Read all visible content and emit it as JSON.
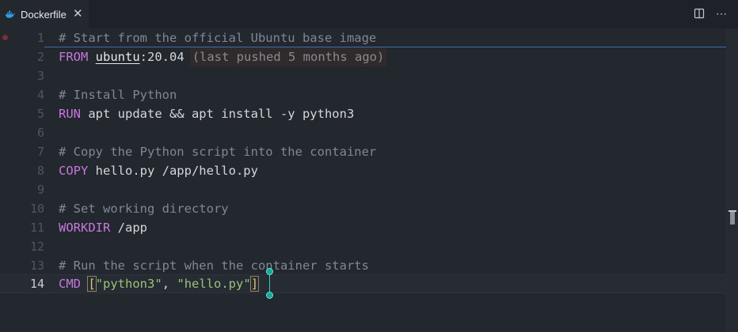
{
  "tab": {
    "title": "Dockerfile",
    "icon": "docker-icon",
    "close_glyph": "✕"
  },
  "actions": {
    "split_icon": "split-editor-icon",
    "more_glyph": "⋯"
  },
  "colors": {
    "background": "#23272e",
    "keyword": "#c678dd",
    "comment": "#7f8896",
    "string": "#98c379",
    "number": "#d19a66",
    "cursor": "#2bd0c0"
  },
  "lines": [
    {
      "number": "1",
      "text": "# Start from the official Ubuntu base image"
    },
    {
      "number": "2",
      "keyword": "FROM",
      "image": "ubuntu",
      "sep": ":",
      "tag": "20.04",
      "hint": "(last pushed 5 months ago)"
    },
    {
      "number": "3"
    },
    {
      "number": "4",
      "text": "# Install Python"
    },
    {
      "number": "5",
      "keyword": "RUN",
      "rest": " apt update && apt install -y python3"
    },
    {
      "number": "6"
    },
    {
      "number": "7",
      "text": "# Copy the Python script into the container"
    },
    {
      "number": "8",
      "keyword": "COPY",
      "rest": " hello.py /app/hello.py"
    },
    {
      "number": "9"
    },
    {
      "number": "10",
      "text": "# Set working directory"
    },
    {
      "number": "11",
      "keyword": "WORKDIR",
      "rest": " /app"
    },
    {
      "number": "12"
    },
    {
      "number": "13",
      "text": "# Run the script when the container starts"
    },
    {
      "number": "14",
      "keyword": "CMD",
      "open": "[",
      "arg1": "\"python3\"",
      "comma": ", ",
      "arg2": "\"hello.py\"",
      "close": "]"
    }
  ]
}
